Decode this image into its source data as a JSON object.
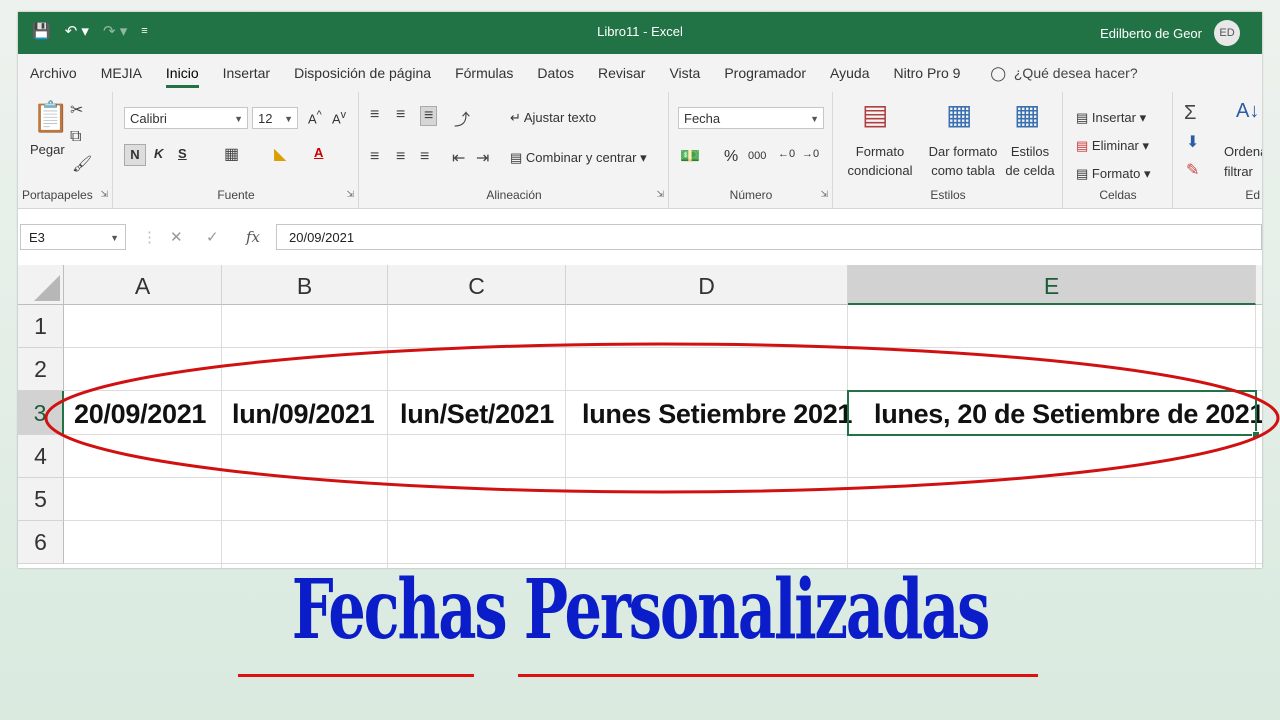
{
  "window": {
    "title": "Libro11  -  Excel",
    "user": "Edilberto de Geor",
    "avatar": "ED"
  },
  "menu_tabs": [
    "Archivo",
    "MEJIA",
    "Inicio",
    "Insertar",
    "Disposición de página",
    "Fórmulas",
    "Datos",
    "Revisar",
    "Vista",
    "Programador",
    "Ayuda",
    "Nitro Pro 9"
  ],
  "tell_me": "¿Qué desea hacer?",
  "ribbon": {
    "clipboard": {
      "paste": "Pegar",
      "group": "Portapapeles"
    },
    "font": {
      "name": "Calibri",
      "size": "12",
      "bold": "N",
      "italic": "K",
      "underline": "S",
      "group": "Fuente"
    },
    "alignment": {
      "wrap": "Ajustar texto",
      "merge": "Combinar y centrar",
      "group": "Alineación"
    },
    "number": {
      "format": "Fecha",
      "percent": "%",
      "thousands": "000",
      "group": "Número"
    },
    "styles": {
      "conditional": "Formato condicional",
      "as_table": "Dar formato como tabla",
      "cell_styles": "Estilos de celda",
      "group": "Estilos"
    },
    "cells": {
      "insert": "Insertar",
      "delete": "Eliminar",
      "format": "Formato",
      "group": "Celdas"
    },
    "editing": {
      "sort": "Ordenar y filtrar",
      "sort_short": "Ordena",
      "filter_short": "filtrar",
      "group_short": "Ed"
    }
  },
  "formula_bar": {
    "name_box": "E3",
    "formula": "20/09/2021"
  },
  "grid": {
    "columns": [
      "A",
      "B",
      "C",
      "D",
      "E"
    ],
    "rows": [
      "1",
      "2",
      "3",
      "4",
      "5",
      "6"
    ],
    "selected_cell": "E3",
    "row3": {
      "A": "20/09/2021",
      "B": "lun/09/2021",
      "C": "lun/Set/2021",
      "D": "lunes Setiembre 2021",
      "E": "lunes, 20 de Setiembre de 2021"
    }
  },
  "headline": "Fechas Personalizadas",
  "colors": {
    "excel_green": "#217346",
    "headline_blue": "#0a1dc8",
    "annotation_red": "#d11111"
  }
}
